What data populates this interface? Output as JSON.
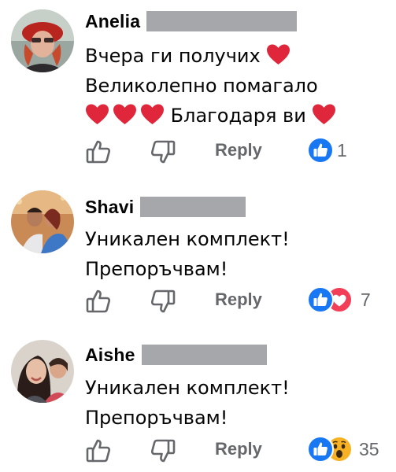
{
  "comments": [
    {
      "author": "Anelia",
      "lines": [
        "Вчера ги получих",
        "Великолепно помагало",
        "Благодаря ви"
      ],
      "reply_label": "Reply",
      "reaction_count": "1",
      "reactions": [
        "like"
      ]
    },
    {
      "author": "Shavi",
      "lines": [
        "Уникален комплект!",
        "Препоръчвам!"
      ],
      "reply_label": "Reply",
      "reaction_count": "7",
      "reactions": [
        "like",
        "love"
      ]
    },
    {
      "author": "Aishe",
      "lines": [
        "Уникален комплект!",
        "Препоръчвам!"
      ],
      "reply_label": "Reply",
      "reaction_count": "35",
      "reactions": [
        "like",
        "wow"
      ]
    }
  ],
  "icons": {
    "like_up": "thumbs-up-icon",
    "like_down": "thumbs-down-icon",
    "heart": "red-heart-emoji",
    "reaction_like": "like-reaction-icon",
    "reaction_love": "love-reaction-icon",
    "reaction_wow": "wow-reaction-icon"
  },
  "colors": {
    "text": "#050505",
    "muted": "#65676b",
    "redaction": "#a5a7ab",
    "like_blue": "#1877f2",
    "love_red": "#f33e58",
    "heart_red": "#e0263b",
    "wow_yellow": "#f7b125"
  }
}
